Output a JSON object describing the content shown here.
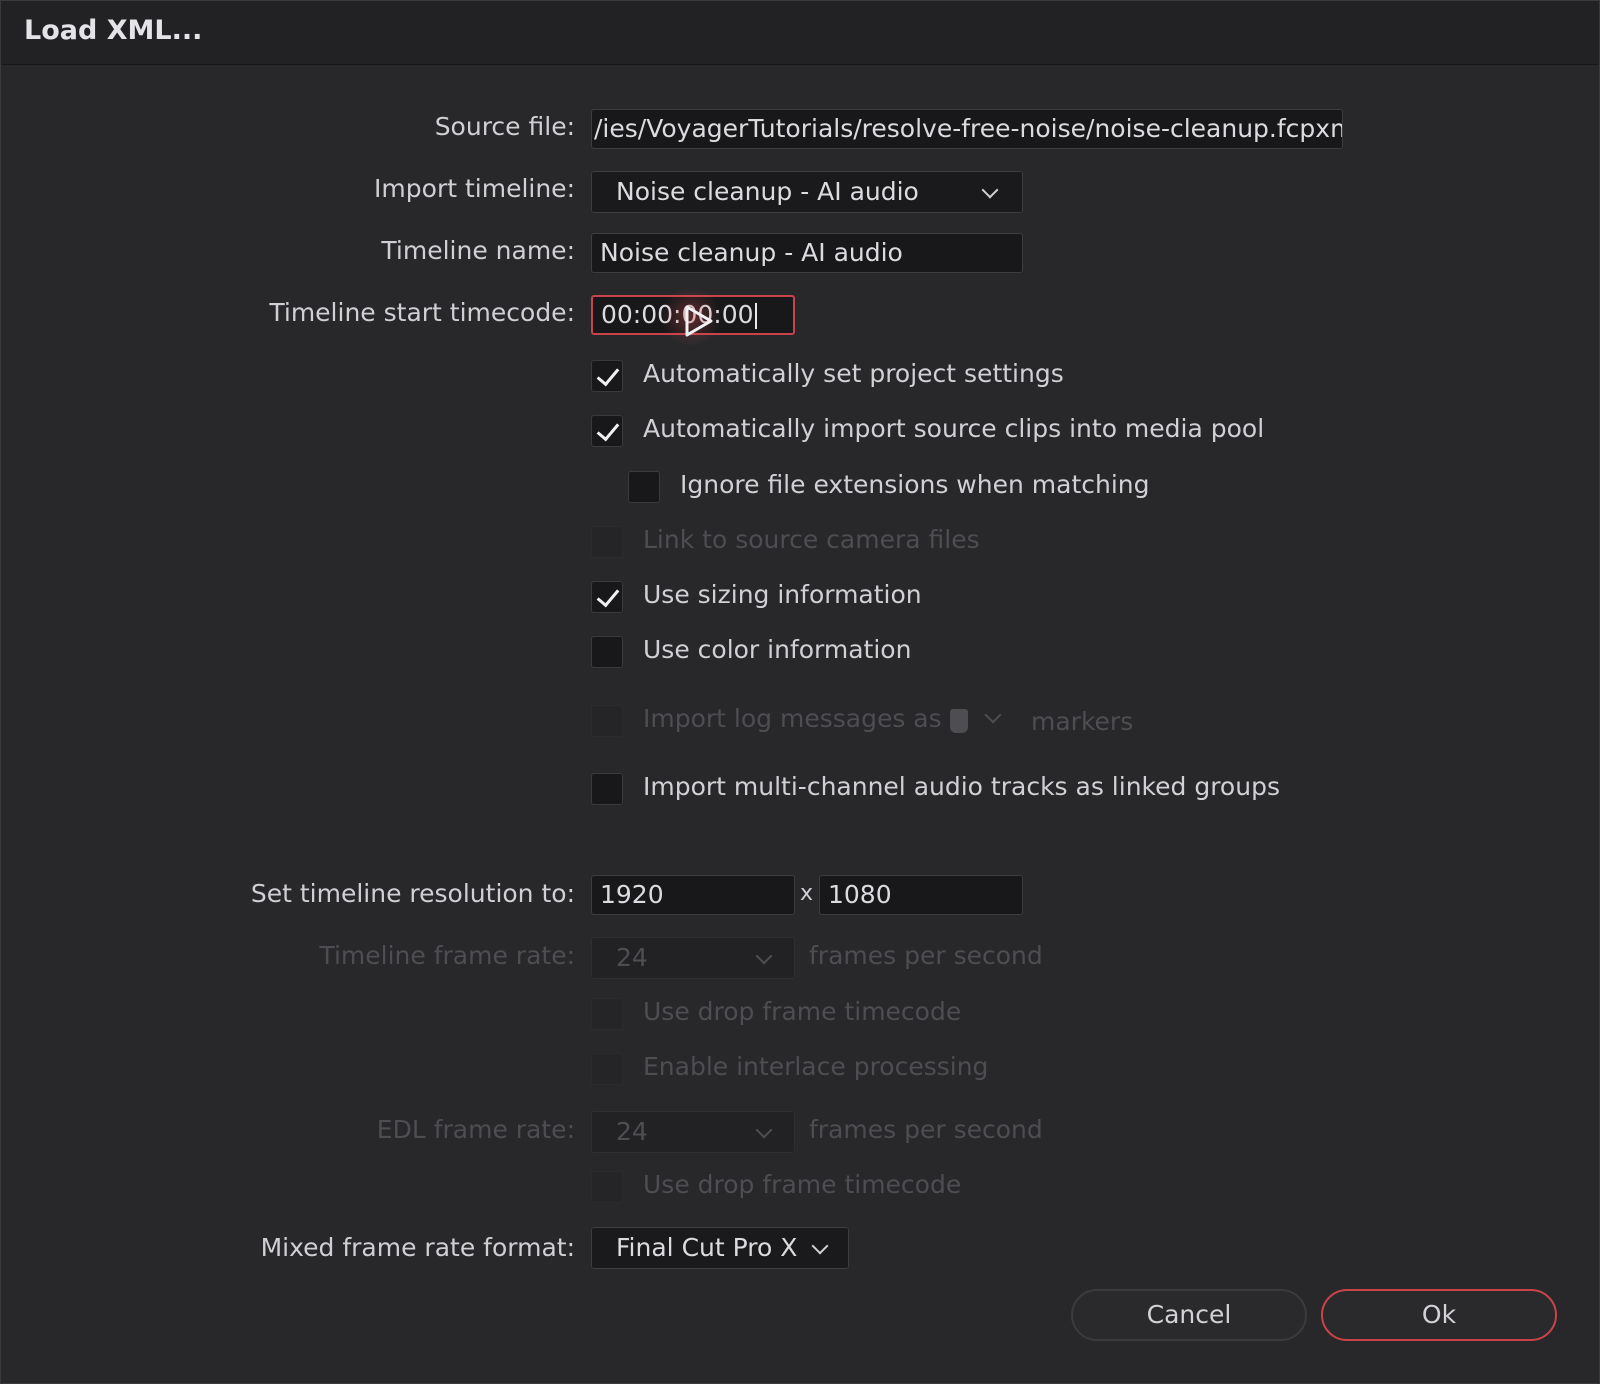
{
  "dialog": {
    "title": "Load XML..."
  },
  "source_file": {
    "label": "Source file:",
    "value": "/ies/VoyagerTutorials/resolve-free-noise/noise-cleanup.fcpxml"
  },
  "import_timeline": {
    "label": "Import timeline:",
    "value": "Noise cleanup - AI audio"
  },
  "timeline_name": {
    "label": "Timeline name:",
    "value": "Noise cleanup - AI audio"
  },
  "start_timecode": {
    "label": "Timeline start timecode:",
    "value": "00:00:00:00"
  },
  "options": {
    "auto_project_settings": {
      "label": "Automatically set project settings",
      "checked": true
    },
    "auto_import_clips": {
      "label": "Automatically import source clips into media pool",
      "checked": true
    },
    "ignore_extensions": {
      "label": "Ignore file extensions when matching",
      "checked": false
    },
    "link_camera_files": {
      "label": "Link to source camera files",
      "checked": false
    },
    "use_sizing": {
      "label": "Use sizing information",
      "checked": true
    },
    "use_color": {
      "label": "Use color information",
      "checked": false
    },
    "import_log": {
      "label": "Import log messages as",
      "suffix": "markers",
      "checked": false
    },
    "multichannel_audio": {
      "label": "Import multi-channel audio tracks as linked groups",
      "checked": false
    }
  },
  "resolution": {
    "label": "Set timeline resolution to:",
    "width": "1920",
    "separator": "x",
    "height": "1080"
  },
  "frame_rate": {
    "label": "Timeline frame rate:",
    "value": "24",
    "unit": "frames per second",
    "drop_frame_label": "Use drop frame timecode",
    "interlace_label": "Enable interlace processing"
  },
  "edl_frame_rate": {
    "label": "EDL frame rate:",
    "value": "24",
    "unit": "frames per second",
    "drop_frame_label": "Use drop frame timecode"
  },
  "mixed_frame_rate": {
    "label": "Mixed frame rate format:",
    "value": "Final Cut Pro X"
  },
  "buttons": {
    "cancel": "Cancel",
    "ok": "Ok"
  },
  "colors": {
    "accent": "#c9444a",
    "background": "#28282b",
    "field": "#18181a"
  }
}
